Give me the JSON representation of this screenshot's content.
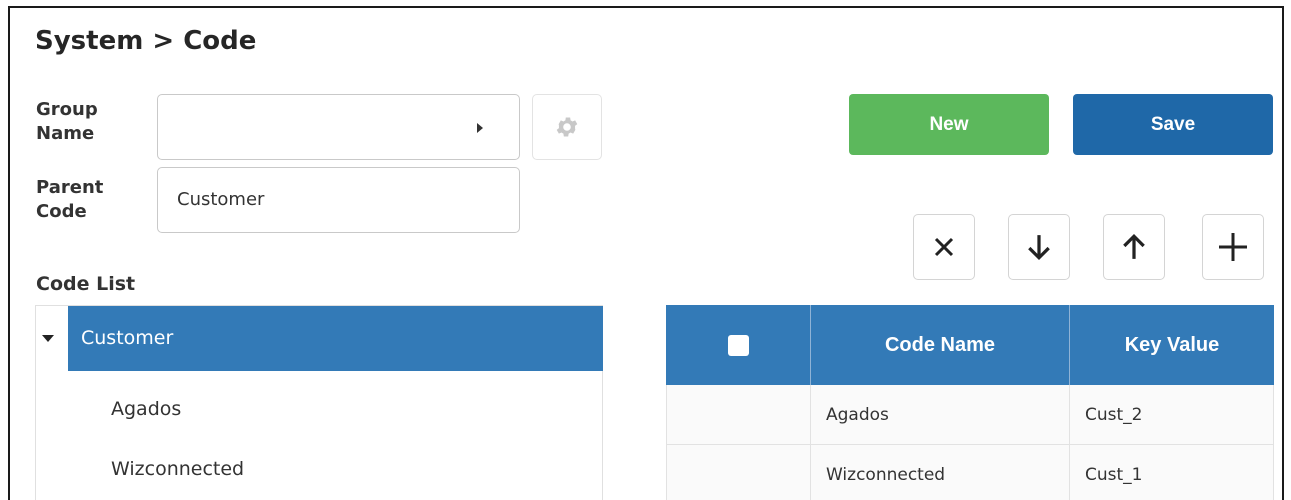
{
  "page": {
    "title": "System > Code"
  },
  "form": {
    "group_name_label": "Group\nName",
    "group_name_value": "",
    "parent_code_label": "Parent\nCode",
    "parent_code_value": "Customer",
    "code_list_label": "Code List"
  },
  "toolbar": {
    "new_label": "New",
    "save_label": "Save"
  },
  "tree": {
    "root": {
      "label": "Customer",
      "expanded": true,
      "selected": true
    },
    "children": [
      "Agados",
      "Wizconnected"
    ]
  },
  "grid": {
    "columns": [
      "",
      "Code Name",
      "Key Value"
    ],
    "rows": [
      {
        "code_name": "Agados",
        "key_value": "Cust_2"
      },
      {
        "code_name": "Wizconnected",
        "key_value": "Cust_1"
      }
    ]
  },
  "icons": [
    "gear-icon",
    "close-icon",
    "arrow-down-icon",
    "arrow-up-icon",
    "plus-icon",
    "caret-right-icon",
    "caret-down-icon",
    "checkbox-icon"
  ],
  "colors": {
    "accent": "#337ab7",
    "new_button": "#5cb85c",
    "save_button": "#1f68a8"
  }
}
